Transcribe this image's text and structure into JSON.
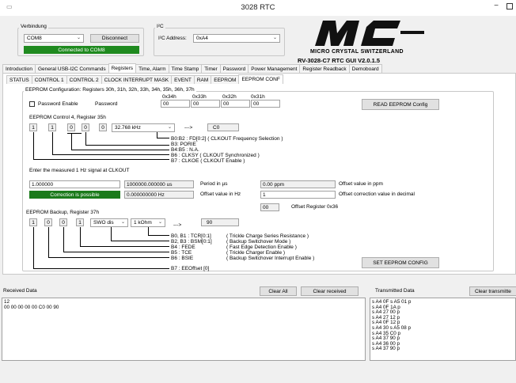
{
  "titlebar": {
    "title": "3028 RTC",
    "minimize": "−"
  },
  "verbindung": {
    "group_label": "Verbindung",
    "port": "COM8",
    "disconnect": "Disconnect",
    "status": "Connected to COM8"
  },
  "i2c": {
    "group_label": "I²C",
    "address_label": "I²C Address:",
    "address": "0xA4"
  },
  "logo": {
    "company": "MICRO CRYSTAL SWITZERLAND",
    "product": "RV-3028-C7   RTC GUI V2.0.1.5"
  },
  "main_tabs": [
    "Introduction",
    "General USB-I2C Commands",
    "Registers",
    "Time, Alarm",
    "Time Stamp",
    "Timer",
    "Password",
    "Power Management",
    "Register Readback",
    "Demoboard"
  ],
  "sub_tabs": [
    "STATUS",
    "CONTROL 1",
    "CONTROL 2",
    "CLOCK INTERRUPT MASK",
    "EVENT",
    "RAM",
    "EEPROM",
    "EEPROM CONF"
  ],
  "eeprom_conf": {
    "group_label": "EEPROM Configuration: Registers 30h, 31h, 32h, 33h, 34h, 35h, 36h, 37h",
    "reg_labels": [
      "0x34h",
      "0x33h",
      "0x32h",
      "0x31h"
    ],
    "reg_values": [
      "00",
      "00",
      "00",
      "00"
    ],
    "password_enable": "Password Enable",
    "password_label": "Password",
    "read_button": "READ EEPROM Config",
    "control4_label": "EEPROM Control 4, Register 35h",
    "control4_bits": [
      "1",
      "1",
      "0",
      "0",
      "0"
    ],
    "clkout_freq": "32.768 kHz",
    "arrow": "--->",
    "control4_result": "C0",
    "control4_desc": [
      "B0:B2 : FD[0:2] ( CLKOUT Frequency Selection )",
      "B3: PORIE",
      "B4:B5 : N.A.",
      "B6 : CLKSY ( CLKOUT Synchronized )",
      "B7 : CLKOE ( CLKOUT Enable )"
    ],
    "measured_label": "Enter the measured 1 Hz signal at CLKOUT",
    "measured_value": "1.000000",
    "period_value": "1000000.000000 us",
    "period_label": "Period in µs",
    "ppm_value": "0.00 ppm",
    "ppm_label": "Offset value in ppm",
    "correction_status": "Correction is possible",
    "hz_value": "0.000000000 Hz",
    "hz_label": "Offset value in Hz",
    "decimal_value": "1",
    "decimal_label": "Offset correction value in decimal",
    "offset_reg_value": "00",
    "offset_reg_label": "Offset Register 0x36",
    "backup_label": "EEPROM Backup, Register 37h",
    "backup_bits": [
      "1",
      "0",
      "0",
      "1"
    ],
    "swo_mode": "SWO dis",
    "resistance": "1 kOhm",
    "backup_result": "90",
    "backup_desc": [
      "B0, B1 : TCR[0:1]",
      "B2, B3 : BSM[0:1]",
      "B4 : FEDE",
      "B5 : TCE",
      "B6 : BSIE",
      "B7 : EEOffset [0]"
    ],
    "backup_desc_right": [
      "( Trickle Charge Series Resistance )",
      "( Backup Switchover Mode )",
      "( Fast Edge Detection Enable )",
      "( Trickle Charger Enable )",
      "( Backup Switchover Interrupt Enable )"
    ],
    "set_button": "SET EEPROM CONFIG"
  },
  "received": {
    "label": "Received Data",
    "clear_all": "Clear All",
    "clear_received": "Clear received",
    "content": "12\n00 00 00 00 00 C0 00 90"
  },
  "transmitted": {
    "label": "Transmitted Data",
    "clear_button": "Clear transmitte",
    "content": "s A4 0F s A5 01 p\ns A4 0F 1A p\ns A4 27 00 p\ns A4 27 12 p\ns A4 0F 12 p\ns A4 30 s A5 08 p\ns A4 35 C0 p\ns A4 37 90 p\ns A4 36 00 p\ns A4 37 90 p"
  }
}
